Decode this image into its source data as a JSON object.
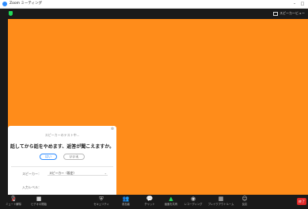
{
  "window": {
    "title": "Zoom ミーティング",
    "controls": [
      "–",
      "□"
    ]
  },
  "header": {
    "view_label": "スピーカービュー"
  },
  "dialog": {
    "subtitle": "スピーカーのテスト中...",
    "question": "話してから話をやめます、返答が聞こえますか。",
    "yes_label": "はい",
    "no_label": "いいえ",
    "speaker_label": "スピーカー：",
    "speaker_value": "スピーカー（既定）",
    "input_label": "入力レベル："
  },
  "toolbar": {
    "items": [
      {
        "icon": "microphone-icon",
        "label": "ミュート解除"
      },
      {
        "icon": "video-icon",
        "label": "ビデオの開始"
      },
      {
        "icon": "security-icon",
        "label": "セキュリティ"
      },
      {
        "icon": "participants-icon",
        "label": "参加者"
      },
      {
        "icon": "chat-icon",
        "label": "チャット"
      },
      {
        "icon": "share-screen-icon",
        "label": "画面を共有"
      },
      {
        "icon": "record-icon",
        "label": "レコーディング"
      },
      {
        "icon": "breakout-rooms-icon",
        "label": "ブレイクアウトルーム"
      },
      {
        "icon": "reactions-icon",
        "label": "反応"
      }
    ],
    "end_label": "終了"
  },
  "colors": {
    "video_bg": "#ff8c1a",
    "share_green": "#23d959",
    "end_red": "#e02828",
    "accent_blue": "#2d8cff"
  }
}
